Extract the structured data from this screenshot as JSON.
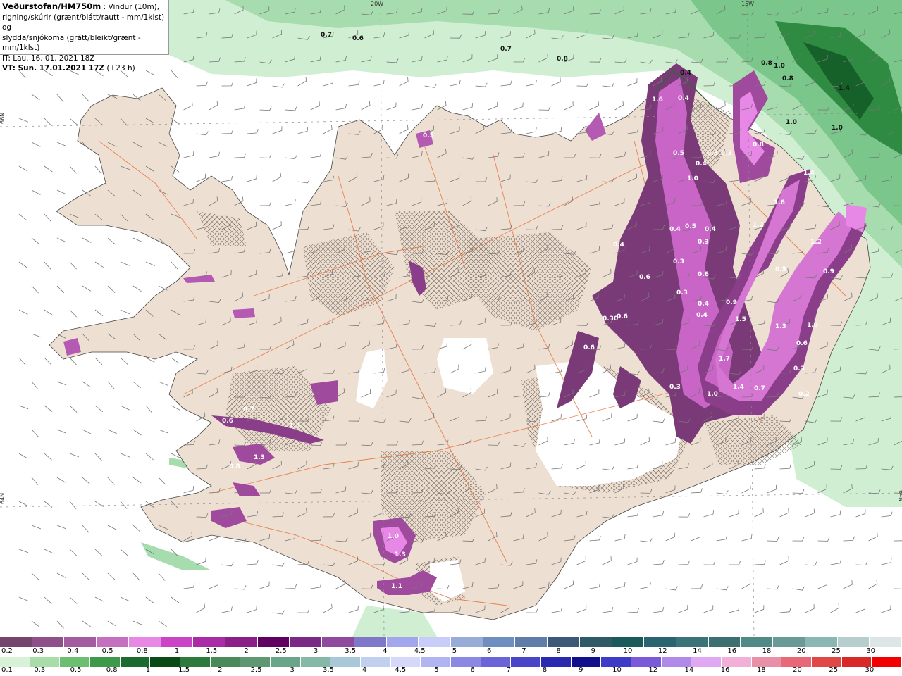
{
  "header": {
    "title": "Veðurstofan/HM750m",
    "title_suffix": " : Vindur (10m),",
    "line2": "rigning/skúrir (grænt/blátt/rautt - mm/1klst) og",
    "line3": "slydda/snjókoma (grátt/bleikt/grænt - mm/1klst)",
    "init_time": "IT: Lau. 16. 01. 2021 18Z",
    "valid_time": "VT: Sun. 17.01.2021 17Z",
    "valid_offset": " (+23 h)"
  },
  "graticule": {
    "lon_labels": [
      "20W",
      "15W"
    ],
    "lat_labels": [
      "66N",
      "64N"
    ]
  },
  "map_numbers": [
    "0.7",
    "0.6",
    "0.7",
    "0.8",
    "0.8",
    "1.0",
    "0.8",
    "1.4",
    "1.0",
    "1.0",
    "0.4",
    "1.6",
    "0.4",
    "0.5",
    "0.3",
    "0.3",
    "0.4",
    "0.8",
    "1.0",
    "1.4",
    "1.6",
    "0.4",
    "0.5",
    "0.4",
    "0.3",
    "1.2",
    "0.4",
    "0.6",
    "0.3",
    "0.6",
    "0.3",
    "0.5",
    "0.4",
    "1.5",
    "0.30",
    "0.6",
    "0.4",
    "0.9",
    "1.3",
    "1.0",
    "0.6",
    "1.7",
    "1.4",
    "0.7",
    "1.0",
    "0.3",
    "0.2",
    "0.3",
    "0.5",
    "0.7",
    "0.6",
    "1.5",
    "1.3",
    "0.8",
    "1.0",
    "1.3",
    "1.1",
    "1.2",
    "0.6",
    "0.9"
  ],
  "legend": {
    "snow_colors": [
      "#74466e",
      "#8e4f8a",
      "#a45ca0",
      "#c46fc0",
      "#e888e6",
      "#cc44c6",
      "#aa2ba6",
      "#8a1f88",
      "#600060",
      "#7a2a86",
      "#8f4aa0",
      "#7f78c8",
      "#a2a6ec",
      "#c8ccf8",
      "#98acd8",
      "#6f8ec0",
      "#5f7da8",
      "#3c5a78",
      "#2d5a66",
      "#1b5a5a",
      "#2a6470",
      "#3a7478",
      "#3c7070",
      "#4f8a86",
      "#6a9a98",
      "#8ab6b4",
      "#b6cece",
      "#dde6e6"
    ],
    "snow_labels": [
      "0.2",
      "0.3",
      "0.4",
      "0.5",
      "0.8",
      "1",
      "1.5",
      "2",
      "2.5",
      "3",
      "3.5",
      "4",
      "4.5",
      "5",
      "6",
      "7",
      "8",
      "9",
      "10",
      "12",
      "14",
      "16",
      "18",
      "20",
      "25",
      "30"
    ],
    "rain_colors": [
      "#d8f2d8",
      "#a8dca8",
      "#6cbf70",
      "#3c9a4a",
      "#1b6b2e",
      "#0a4a16",
      "#2e7a3c",
      "#4a8a5a",
      "#5f9870",
      "#6aa48a",
      "#86b8a8",
      "#a8c8d8",
      "#c2d0f0",
      "#d6d8fa",
      "#b0b4f0",
      "#8a88e4",
      "#6a64d8",
      "#4a44c8",
      "#2a2ab0",
      "#10108c",
      "#3c3cc8",
      "#7a5ad8",
      "#b08ae8",
      "#e0a8f0",
      "#f0b0d8",
      "#e890a8",
      "#e86878",
      "#e04848",
      "#d82828",
      "#f00000"
    ],
    "rain_labels": [
      "0.1",
      "0.3",
      "0.5",
      "0.8",
      "1",
      "1.5",
      "2",
      "2.5",
      "3",
      "3.5",
      "4",
      "4.5",
      "5",
      "6",
      "7",
      "8",
      "9",
      "10",
      "12",
      "14",
      "16",
      "18",
      "20",
      "25",
      "30"
    ]
  }
}
